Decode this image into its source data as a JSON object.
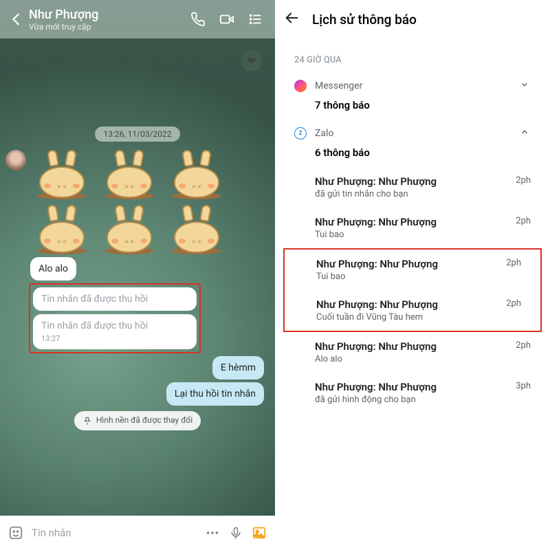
{
  "chat": {
    "contact_name": "Như Phượng",
    "contact_status": "Vừa mới truy cập",
    "heart_emoji": "❤",
    "thread_timestamp": "13:26, 11/03/2022",
    "messages": {
      "alo": "Alo alo",
      "recalled_1": "Tin nhắn đã được thu hồi",
      "recalled_2": "Tin nhắn đã được thu hồi",
      "recalled_time": "13:27",
      "reply_1": "E hèmm",
      "reply_2": "Lại thu hồi tin nhắn",
      "system_bg": "Hình nền đã được thay đổi"
    },
    "input_placeholder": "Tin nhắn"
  },
  "notif": {
    "title": "Lịch sử thông báo",
    "section": "24 GIỜ QUA",
    "apps": {
      "messenger": {
        "name": "Messenger",
        "count": "7 thông báo"
      },
      "zalo": {
        "name": "Zalo",
        "count": "6 thông báo"
      }
    },
    "items": [
      {
        "sender": "Như Phượng: Như Phượng",
        "body": "đã gửi tin nhắn cho bạn",
        "time": "2ph"
      },
      {
        "sender": "Như Phượng: Như Phượng",
        "body": "Tui bao",
        "time": "2ph"
      },
      {
        "sender": "Như Phượng: Như Phượng",
        "body": "Tui bao",
        "time": "2ph"
      },
      {
        "sender": "Như Phượng: Như Phượng",
        "body": "Cuối tuần đi Vũng Tàu hem",
        "time": "2ph"
      },
      {
        "sender": "Như Phượng: Như Phượng",
        "body": "Alo alo",
        "time": "2ph"
      },
      {
        "sender": "Như Phượng: Như Phượng",
        "body": "đã gửi hình động cho bạn",
        "time": "3ph"
      }
    ]
  }
}
